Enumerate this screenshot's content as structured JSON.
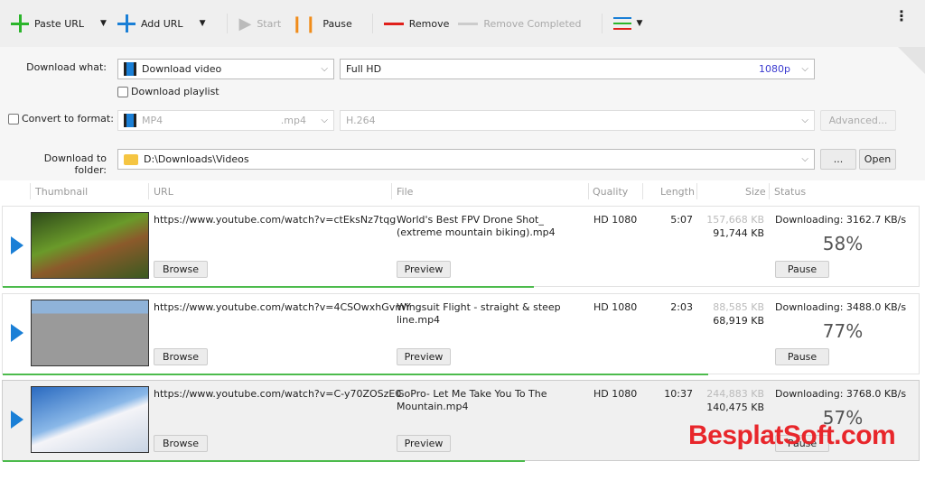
{
  "toolbar": {
    "paste_url": "Paste URL",
    "add_url": "Add URL",
    "start": "Start",
    "pause": "Pause",
    "remove": "Remove",
    "remove_completed": "Remove Completed",
    "colors": {
      "paste": "#2bb52b",
      "add": "#1a7fd6",
      "pause": "#f08c1a",
      "remove": "#e0201b"
    }
  },
  "form": {
    "download_what_label": "Download what:",
    "download_what_value": "Download video",
    "quality_value": "Full HD",
    "quality_res": "1080p",
    "playlist_label": "Download playlist",
    "convert_label": "Convert to format:",
    "format_value": "MP4",
    "format_ext": ".mp4",
    "codec_value": "H.264",
    "advanced": "Advanced...",
    "folder_label": "Download to folder:",
    "folder_value": "D:\\Downloads\\Videos",
    "browse_dots": "...",
    "open": "Open"
  },
  "columns": {
    "thumbnail": "Thumbnail",
    "url": "URL",
    "file": "File",
    "quality": "Quality",
    "length": "Length",
    "size": "Size",
    "status": "Status"
  },
  "downloads": [
    {
      "url": "https://www.youtube.com/watch?v=ctEksNz7tqg",
      "file": "World's Best FPV Drone Shot_ (extreme mountain biking).mp4",
      "quality": "HD 1080",
      "length": "5:07",
      "total_size": "157,668 KB",
      "downloaded": "91,744 KB",
      "status": "Downloading: 3162.7 KB/s",
      "percent": "58%",
      "progress": 0.58,
      "browse": "Browse",
      "preview": "Preview",
      "pause": "Pause"
    },
    {
      "url": "https://www.youtube.com/watch?v=4CSOwxhGvmY",
      "file": "Wingsuit Flight - straight & steep line.mp4",
      "quality": "HD 1080",
      "length": "2:03",
      "total_size": "88,585 KB",
      "downloaded": "68,919 KB",
      "status": "Downloading: 3488.0 KB/s",
      "percent": "77%",
      "progress": 0.77,
      "browse": "Browse",
      "preview": "Preview",
      "pause": "Pause"
    },
    {
      "url": "https://www.youtube.com/watch?v=C-y70ZOSzE0",
      "file": "GoPro- Let Me Take You To The Mountain.mp4",
      "quality": "HD 1080",
      "length": "10:37",
      "total_size": "244,883 KB",
      "downloaded": "140,475 KB",
      "status": "Downloading: 3768.0 KB/s",
      "percent": "57%",
      "progress": 0.57,
      "browse": "Browse",
      "preview": "Preview",
      "pause": "Pause"
    }
  ],
  "watermark": "BesplatSoft.com"
}
